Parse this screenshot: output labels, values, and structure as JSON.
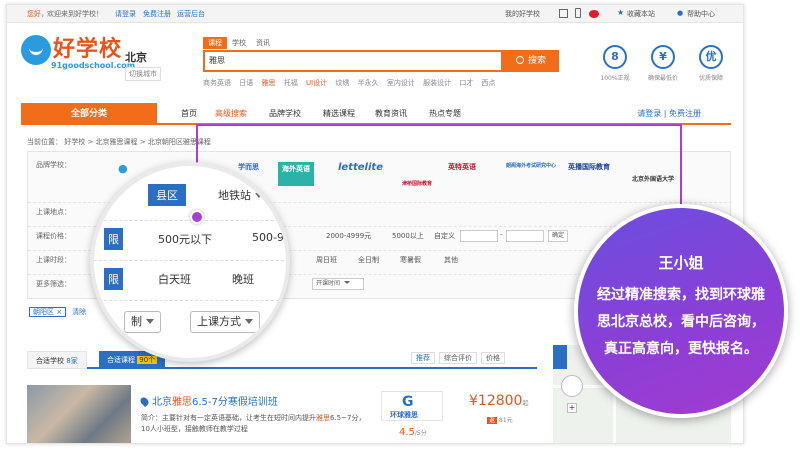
{
  "topbar": {
    "hi": "您好，",
    "welcome": "欢迎来到好学校！",
    "login": "请登录",
    "register": "免费注册",
    "ops": "运营后台",
    "my_school": "我的好学校",
    "bookmark": "收藏本站",
    "help": "帮助中心"
  },
  "logo": {
    "brand": "好学校",
    "domain": "91goodschool.com"
  },
  "city": {
    "name": "北京",
    "switch": "切换城市"
  },
  "search": {
    "tabs": [
      "课程",
      "学校",
      "资讯"
    ],
    "value": "雅思",
    "button": "搜索",
    "hot_words": [
      "商务英语",
      "日语",
      "雅思",
      "托福",
      "UI设计",
      "纹绣",
      "半永久",
      "室内设计",
      "服装设计",
      "口才",
      "西点"
    ]
  },
  "guarantees": [
    {
      "icon": "8",
      "label": "100%正规"
    },
    {
      "icon": "¥",
      "label": "确保最低价"
    },
    {
      "icon": "优",
      "label": "优质保障"
    }
  ],
  "nav": {
    "all": "全部分类",
    "items": [
      "首页",
      "高级搜索",
      "品牌学校",
      "精选课程",
      "教育资讯",
      "热点专题"
    ],
    "login": "请登录",
    "sep": "|",
    "register": "免费注册"
  },
  "breadcrumb": "当前位置： 好学校 > 北京雅思课程 > 北京朝阳区雅思课程",
  "filter": {
    "brand_label": "品牌学校：",
    "brands": [
      "学而思",
      "海外英语",
      "lettelite",
      "津桥国际教育",
      "英特英语",
      "朗阁海外考试研究中心",
      "英播国际教育",
      "北京外国语大学"
    ],
    "location_label": "上课地点：",
    "location_first": "不",
    "price_label": "课程价格：",
    "prices": [
      "2000-4999元",
      "5000以上",
      "自定义"
    ],
    "price_confirm": "确定",
    "time_label": "上课时段：",
    "times": [
      "周日班",
      "全日制",
      "寒暑假",
      "其他"
    ],
    "more_label": "更多筛选：",
    "more_select": "开课时间",
    "dash": "-"
  },
  "selected": {
    "tag": "朝阳区",
    "close": "×",
    "clear": "清除"
  },
  "result_tabs": {
    "schools": "合适学校",
    "schools_count": "8家",
    "courses": "合适课程",
    "courses_count": "90个"
  },
  "sorts": [
    "推荐",
    "综合评价",
    "价格"
  ],
  "result": {
    "title_prefix": "北京",
    "title_hl": "雅思",
    "title_rest": "6.5-7分寒假培训班",
    "desc_a": "简介：主要针对有一定英语基础，让考生在短时间内提升",
    "desc_hl": "雅思",
    "desc_b": "6.5~7分，10人小班型，接触教师在教学过程",
    "school_g": "G",
    "school_name": "环球雅思",
    "rating": "4.5",
    "rating_unit": "/5分",
    "price": "¥12800",
    "price_unit": "起",
    "badge": "返",
    "refund": "81元"
  },
  "magnifier": {
    "county": "县区",
    "metro": "地铁站",
    "price_tag": "限",
    "price1": "500元以下",
    "price2": "500-99",
    "time_tag": "限",
    "time1": "白天班",
    "time2": "晚班",
    "sel1": "制",
    "sel2": "上课方式"
  },
  "bubble": {
    "name": "王小姐",
    "text": "经过精准搜索，找到环球雅思北京总校，看中后咨询，真正高意向，更快报名。"
  }
}
